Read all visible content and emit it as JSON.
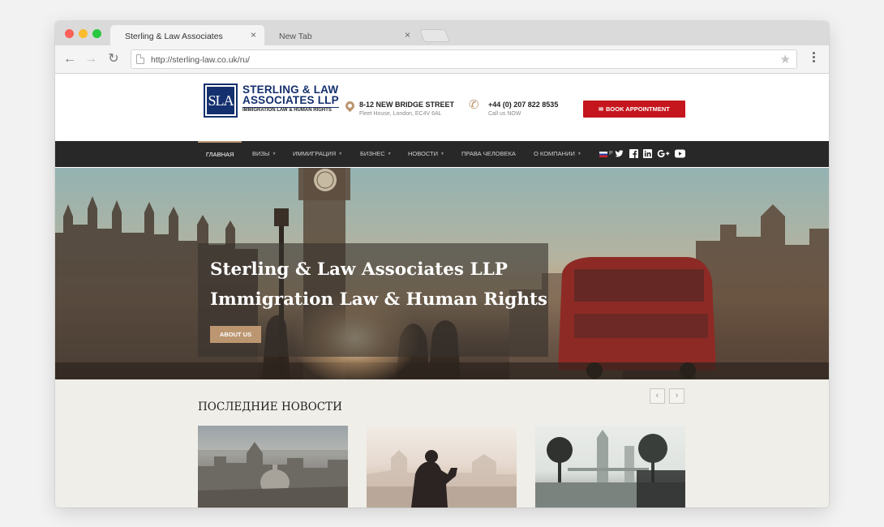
{
  "browser": {
    "tabs": [
      {
        "title": "Sterling & Law Associates",
        "active": true
      },
      {
        "title": "New Tab",
        "active": false
      }
    ],
    "tab_close_glyph": "×",
    "url": "http://sterling-law.co.uk/ru/",
    "icons": {
      "back": "←",
      "forward": "→",
      "reload": "↻",
      "star": "★"
    }
  },
  "header": {
    "logo_mark": "SLA",
    "logo_line1": "STERLING & LAW",
    "logo_line2": "ASSOCIATES LLP",
    "logo_sub": "IMMIGRATION LAW & HUMAN RIGHTS",
    "address_title": "8-12 NEW BRIDGE STREET",
    "address_sub": "Fleet House, London, EC4V 6AL",
    "phone_title": "+44 (0) 207 822 8535",
    "phone_sub": "Call us NOW",
    "phone_glyph": "✆",
    "book_button": "BOOK APPOINTMENT",
    "book_glyph": "✉"
  },
  "nav": {
    "items": [
      {
        "label": "ГЛАВНАЯ",
        "active": true,
        "dropdown": false
      },
      {
        "label": "ВИЗЫ",
        "active": false,
        "dropdown": true
      },
      {
        "label": "ИММИГРАЦИЯ",
        "active": false,
        "dropdown": true
      },
      {
        "label": "БИЗНЕС",
        "active": false,
        "dropdown": true
      },
      {
        "label": "НОВОСТИ",
        "active": false,
        "dropdown": true
      },
      {
        "label": "ПРАВА ЧЕЛОВЕКА",
        "active": false,
        "dropdown": false
      },
      {
        "label": "О КОМПАНИИ",
        "active": false,
        "dropdown": true
      }
    ],
    "caret": "▼",
    "language": "Р",
    "social": [
      "twitter-icon",
      "facebook-icon",
      "linkedin-icon",
      "google-plus-icon",
      "youtube-icon"
    ]
  },
  "hero": {
    "title_line1": "Sterling & Law Associates LLP",
    "title_line2": "Immigration Law & Human Rights",
    "button": "ABOUT US"
  },
  "news": {
    "heading": "ПОСЛЕДНИЕ НОВОСТИ",
    "prev": "‹",
    "next": "›",
    "cards": [
      {
        "image": "london-city-skyline-photo"
      },
      {
        "image": "photographer-by-thames-photo"
      },
      {
        "image": "tower-bridge-photo"
      }
    ]
  },
  "colors": {
    "brand_navy": "#14306e",
    "accent_gold": "#bb9670",
    "cta_red": "#c4161c",
    "nav_bg": "#282828"
  }
}
